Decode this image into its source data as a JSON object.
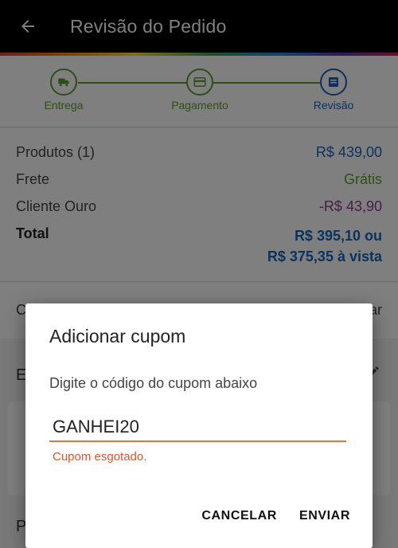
{
  "app_bar": {
    "title": "Revisão do Pedido",
    "back_icon": "arrow-left-icon"
  },
  "stepper": {
    "steps": [
      {
        "label": "Entrega",
        "icon": "truck-icon",
        "state": "done"
      },
      {
        "label": "Pagamento",
        "icon": "card-icon",
        "state": "done"
      },
      {
        "label": "Revisão",
        "icon": "list-icon",
        "state": "current"
      }
    ],
    "colors": {
      "done": "#5a9e2e",
      "current": "#1565c0"
    }
  },
  "summary": {
    "products_label": "Produtos (1)",
    "products_value": "R$ 439,00",
    "shipping_label": "Frete",
    "shipping_value": "Grátis",
    "member_label": "Cliente Ouro",
    "member_value": "-R$ 43,90",
    "total_label": "Total",
    "total_value_line1": "R$ 395,10 ou",
    "total_value_line2": "R$ 375,35 à vista"
  },
  "background": {
    "coupon_row_left": "C",
    "coupon_row_right": "ar",
    "section_letter": "E",
    "section2_letter": "P"
  },
  "dialog": {
    "title": "Adicionar cupom",
    "message": "Digite o código do cupom abaixo",
    "input_value": "GANHEI20",
    "error": "Cupom esgotado.",
    "cancel_label": "CANCELAR",
    "submit_label": "ENVIAR"
  }
}
